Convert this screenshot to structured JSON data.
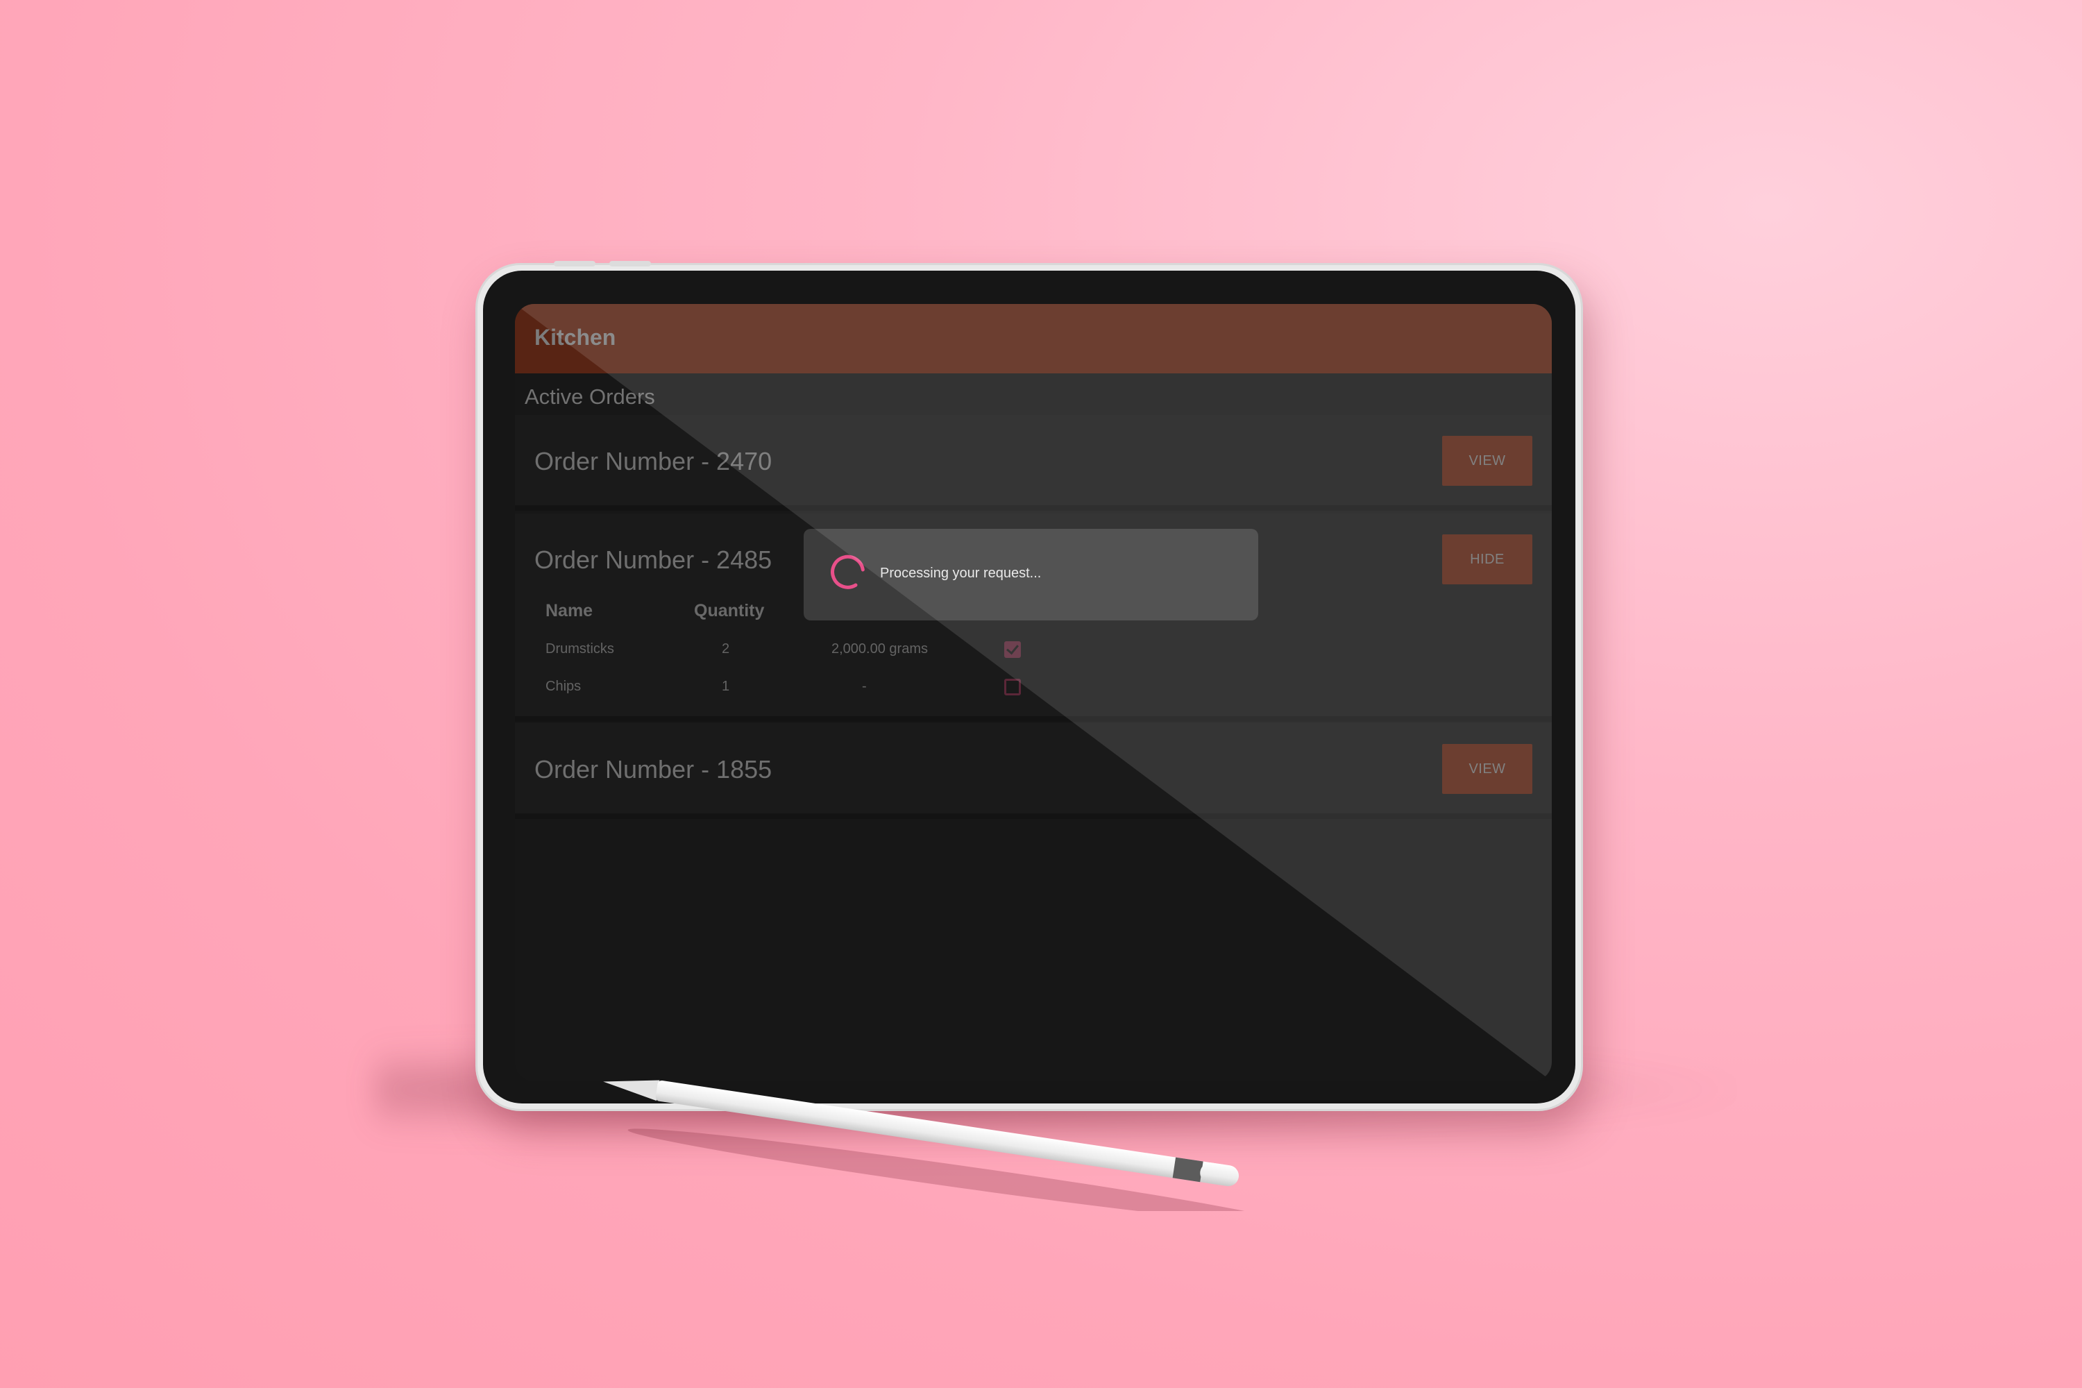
{
  "app": {
    "title": "Kitchen"
  },
  "section": {
    "title": "Active Orders"
  },
  "orders": [
    {
      "title": "Order Number - 2470",
      "action": "VIEW"
    },
    {
      "title": "Order Number - 2485",
      "action": "HIDE",
      "columns": {
        "name": "Name",
        "quantity": "Quantity"
      },
      "items": [
        {
          "name": "Drumsticks",
          "quantity": "2",
          "weight": "2,000.00 grams",
          "checked": true
        },
        {
          "name": "Chips",
          "quantity": "1",
          "weight": "-",
          "checked": false
        }
      ]
    },
    {
      "title": "Order Number - 1855",
      "action": "VIEW"
    }
  ],
  "dialog": {
    "message": "Processing your request..."
  },
  "colors": {
    "accent": "#8e3b21",
    "spinner": "#e8508a",
    "checkbox": "#94405b",
    "background": "#ffa6b9"
  },
  "icons": {
    "spinner": "loading-spinner-icon",
    "check": "checkbox-checked-icon",
    "uncheck": "checkbox-empty-icon"
  }
}
